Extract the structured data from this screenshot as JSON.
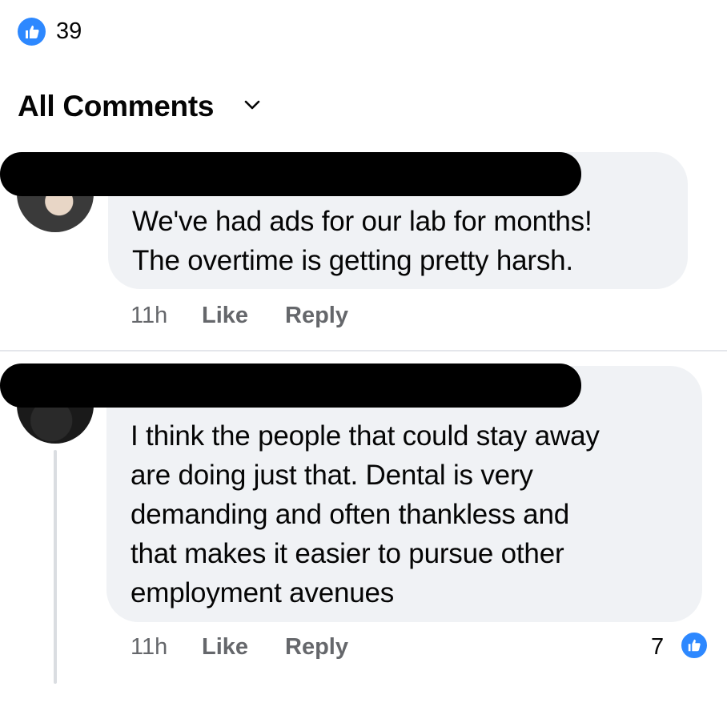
{
  "post_reactions": {
    "icon": "thumbs-up-icon",
    "count": "39",
    "color": "#2d88ff"
  },
  "comments_header": {
    "label": "All Comments",
    "icon": "chevron-down-icon"
  },
  "comments": [
    {
      "text": "We've had ads for our lab for months!\nThe overtime is getting pretty harsh.",
      "time": "11h",
      "like_label": "Like",
      "reply_label": "Reply"
    },
    {
      "text": "I think the people that could stay away\nare doing just that. Dental is very\ndemanding and often thankless and\nthat makes it easier to pursue other\nemployment avenues",
      "time": "11h",
      "like_label": "Like",
      "reply_label": "Reply",
      "reaction_count": "7",
      "reaction_icon": "thumbs-up-icon"
    }
  ]
}
